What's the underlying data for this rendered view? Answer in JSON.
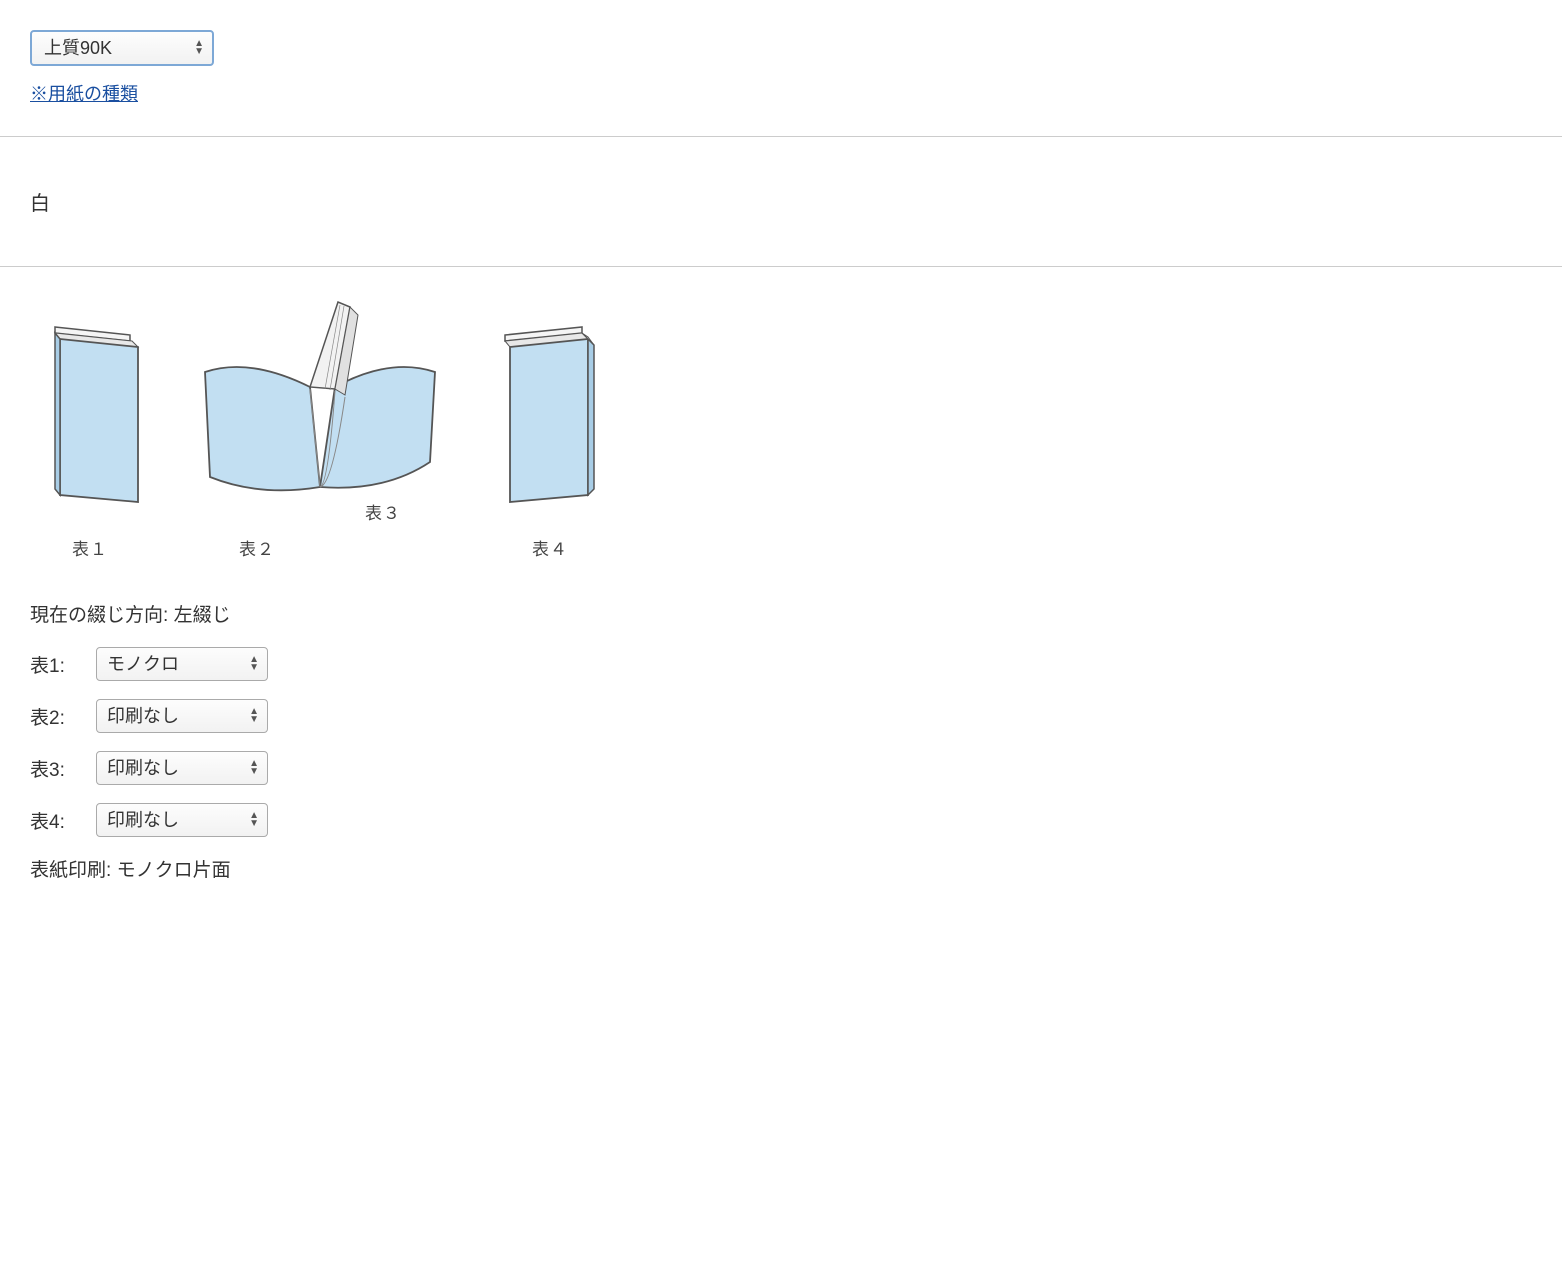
{
  "paper": {
    "selected": "上質90K",
    "type_link": "※用紙の種類"
  },
  "color": {
    "value": "白"
  },
  "diagram": {
    "labels": [
      "表１",
      "表２",
      "表３",
      "表４"
    ]
  },
  "binding": {
    "prefix": "現在の綴じ方向: ",
    "direction": "左綴じ"
  },
  "faces": [
    {
      "label": "表1:",
      "selected": "モノクロ"
    },
    {
      "label": "表2:",
      "selected": "印刷なし"
    },
    {
      "label": "表3:",
      "selected": "印刷なし"
    },
    {
      "label": "表4:",
      "selected": "印刷なし"
    }
  ],
  "summary": {
    "prefix": "表紙印刷: ",
    "value": "モノクロ片面"
  }
}
